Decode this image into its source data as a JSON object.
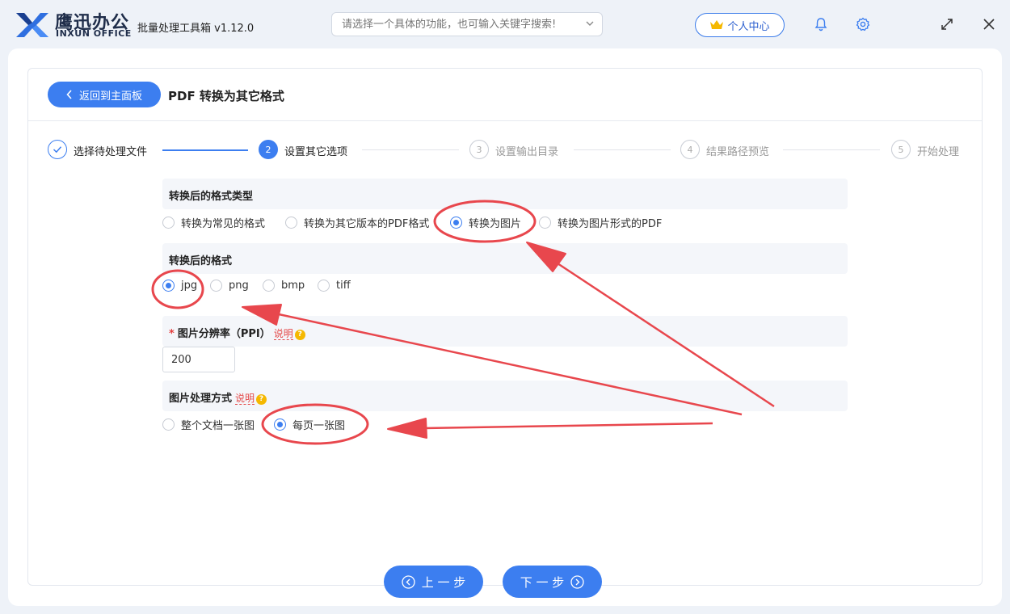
{
  "app": {
    "brand_cn": "鹰迅办公",
    "brand_en": "INXUN OFFICE",
    "title": "批量处理工具箱 v1.12.0",
    "search_placeholder": "请选择一个具体的功能，也可输入关键字搜索!",
    "user_center": "个人中心"
  },
  "header": {
    "back_label": "返回到主面板",
    "page_title": "PDF 转换为其它格式"
  },
  "steps": [
    {
      "num": "1",
      "label": "选择待处理文件",
      "state": "done"
    },
    {
      "num": "2",
      "label": "设置其它选项",
      "state": "active"
    },
    {
      "num": "3",
      "label": "设置输出目录",
      "state": "todo"
    },
    {
      "num": "4",
      "label": "结果路径预览",
      "state": "todo"
    },
    {
      "num": "5",
      "label": "开始处理",
      "state": "todo"
    }
  ],
  "sections": {
    "format_type": {
      "title": "转换后的格式类型",
      "options": [
        "转换为常见的格式",
        "转换为其它版本的PDF格式",
        "转换为图片",
        "转换为图片形式的PDF"
      ],
      "selected": "转换为图片"
    },
    "format": {
      "title": "转换后的格式",
      "options": [
        "jpg",
        "png",
        "bmp",
        "tiff"
      ],
      "selected": "jpg"
    },
    "resolution": {
      "required_mark": "*",
      "title": "图片分辨率（PPI）",
      "help": "说明",
      "value": "200"
    },
    "processing": {
      "title": "图片处理方式",
      "help": "说明",
      "options": [
        "整个文档一张图",
        "每页一张图"
      ],
      "selected": "每页一张图"
    }
  },
  "footer": {
    "prev_label": "上 一 步",
    "next_label": "下 一 步"
  },
  "colors": {
    "accent": "#3c7ef0",
    "annotation": "#e8474d"
  }
}
